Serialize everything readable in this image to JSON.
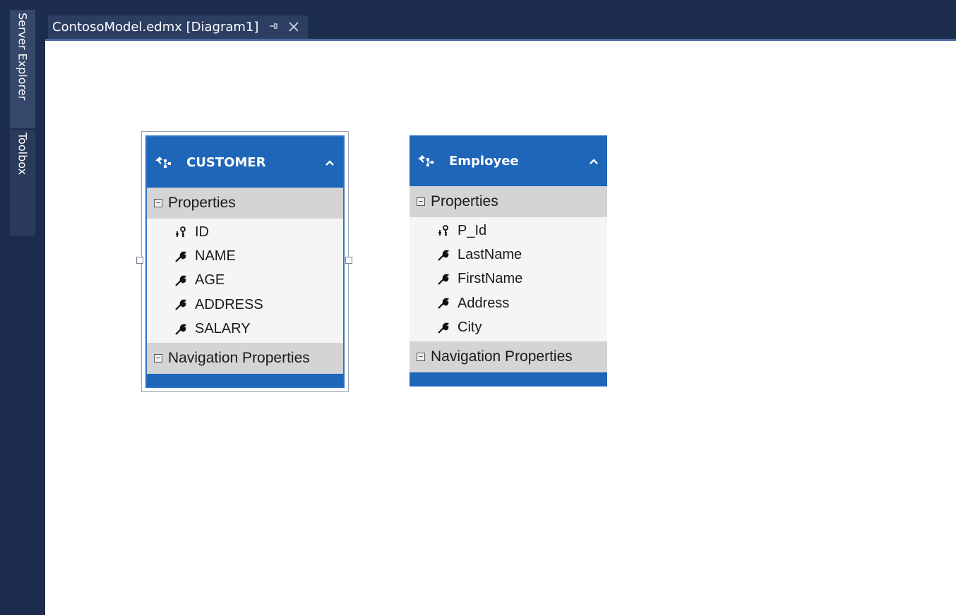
{
  "dock": {
    "tabs": [
      {
        "label": "Server Explorer"
      },
      {
        "label": "Toolbox"
      }
    ]
  },
  "document_tab": {
    "title": "ContosoModel.edmx [Diagram1]",
    "pin_icon": "pin-icon",
    "close_icon": "close-icon"
  },
  "entities": [
    {
      "name": "CUSTOMER",
      "sections": {
        "properties": "Properties",
        "navigation": "Navigation Properties"
      },
      "properties": [
        {
          "name": "ID",
          "icon": "key-icon"
        },
        {
          "name": "NAME",
          "icon": "wrench-icon"
        },
        {
          "name": "AGE",
          "icon": "wrench-icon"
        },
        {
          "name": "ADDRESS",
          "icon": "wrench-icon"
        },
        {
          "name": "SALARY",
          "icon": "wrench-icon"
        }
      ]
    },
    {
      "name": "Employee",
      "sections": {
        "properties": "Properties",
        "navigation": "Navigation Properties"
      },
      "properties": [
        {
          "name": "P_Id",
          "icon": "key-icon"
        },
        {
          "name": "LastName",
          "icon": "wrench-icon"
        },
        {
          "name": "FirstName",
          "icon": "wrench-icon"
        },
        {
          "name": "Address",
          "icon": "wrench-icon"
        },
        {
          "name": "City",
          "icon": "wrench-icon"
        }
      ]
    }
  ],
  "colors": {
    "dock_bg": "#1c2c4c",
    "entity_header": "#1e66b8",
    "section_bg": "#d4d4d4",
    "props_bg": "#f5f5f5"
  }
}
